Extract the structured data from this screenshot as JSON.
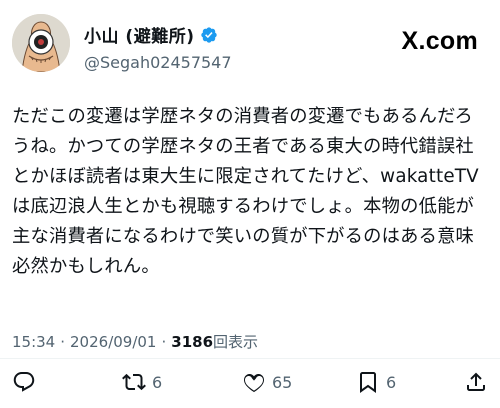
{
  "author": {
    "display_name": "小山 (避難所)",
    "handle": "@Segah02457547",
    "verified": true,
    "avatar_icon": "avatar-illustration-icon"
  },
  "brand": {
    "logo_text": "X.com"
  },
  "post": {
    "text": "ただこの変遷は学歴ネタの消費者の変遷でもあるんだろうね。かつての学歴ネタの王者である東大の時代錯誤社とかほぼ読者は東大生に限定されてたけど、wakatteTVは底辺浪人生とかも視聴するわけでしょ。本物の低能が主な消費者になるわけで笑いの質が下がるのはある意味必然かもしれん。"
  },
  "meta": {
    "time": "15:34",
    "date": "2026/09/01",
    "views_count": "3186",
    "views_label": "回表示",
    "separator": "·"
  },
  "actions": {
    "reply": {
      "icon": "reply-icon"
    },
    "retweet": {
      "icon": "retweet-icon",
      "count": "6"
    },
    "like": {
      "icon": "heart-icon",
      "count": "65"
    },
    "bookmark": {
      "icon": "bookmark-icon",
      "count": "6"
    },
    "share": {
      "icon": "share-icon"
    }
  },
  "colors": {
    "text": "#0f1419",
    "secondary": "#536471",
    "verified": "#1d9bf0",
    "divider": "#eff3f4"
  }
}
